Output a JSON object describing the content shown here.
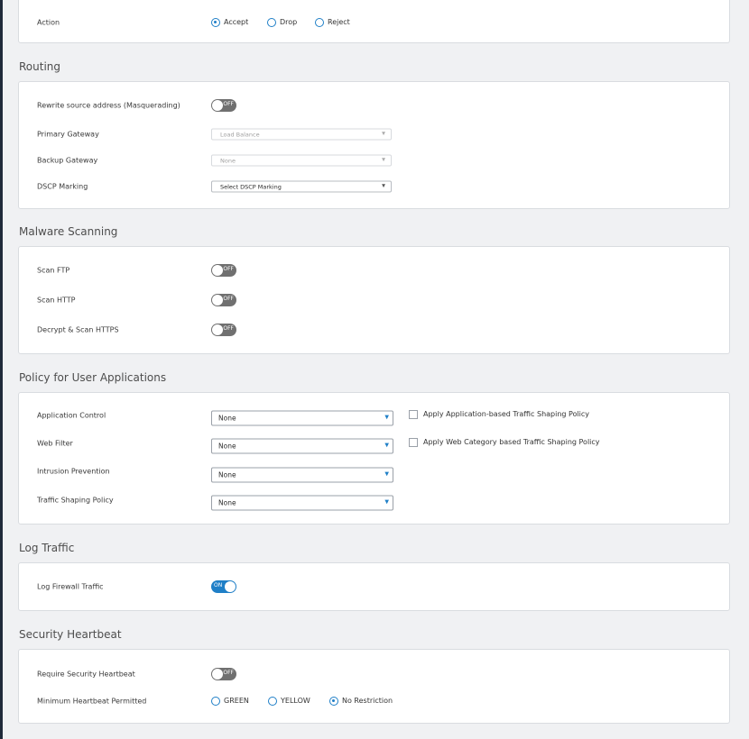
{
  "action": {
    "label": "Action",
    "options": [
      {
        "label": "Accept",
        "checked": true
      },
      {
        "label": "Drop",
        "checked": false
      },
      {
        "label": "Reject",
        "checked": false
      }
    ]
  },
  "routing": {
    "title": "Routing",
    "masquerading_label": "Rewrite source address (Masquerading)",
    "masquerading_toggle": "OFF",
    "primary_gateway_label": "Primary Gateway",
    "primary_gateway_value": "Load Balance",
    "backup_gateway_label": "Backup Gateway",
    "backup_gateway_value": "None",
    "dscp_label": "DSCP Marking",
    "dscp_value": "Select DSCP Marking"
  },
  "malware": {
    "title": "Malware Scanning",
    "scan_ftp_label": "Scan FTP",
    "scan_ftp_toggle": "OFF",
    "scan_http_label": "Scan HTTP",
    "scan_http_toggle": "OFF",
    "decrypt_https_label": "Decrypt & Scan HTTPS",
    "decrypt_https_toggle": "OFF"
  },
  "policy": {
    "title": "Policy for User Applications",
    "app_control_label": "Application Control",
    "app_control_value": "None",
    "app_shaping_label": "Apply Application-based Traffic Shaping Policy",
    "web_filter_label": "Web Filter",
    "web_filter_value": "None",
    "web_shaping_label": "Apply Web Category based Traffic Shaping Policy",
    "ips_label": "Intrusion Prevention",
    "ips_value": "None",
    "traffic_shaping_label": "Traffic Shaping Policy",
    "traffic_shaping_value": "None"
  },
  "log": {
    "title": "Log Traffic",
    "log_firewall_label": "Log Firewall Traffic",
    "log_firewall_toggle": "ON"
  },
  "heartbeat": {
    "title": "Security Heartbeat",
    "require_label": "Require Security Heartbeat",
    "require_toggle": "OFF",
    "minimum_label": "Minimum Heartbeat Permitted",
    "options": [
      {
        "label": "GREEN",
        "checked": false
      },
      {
        "label": "YELLOW",
        "checked": false
      },
      {
        "label": "No Restriction",
        "checked": true
      }
    ]
  },
  "colors": {
    "accent": "#1f7fc7",
    "toggle_off": "#707070",
    "sidebar": "#1f2a3a"
  }
}
